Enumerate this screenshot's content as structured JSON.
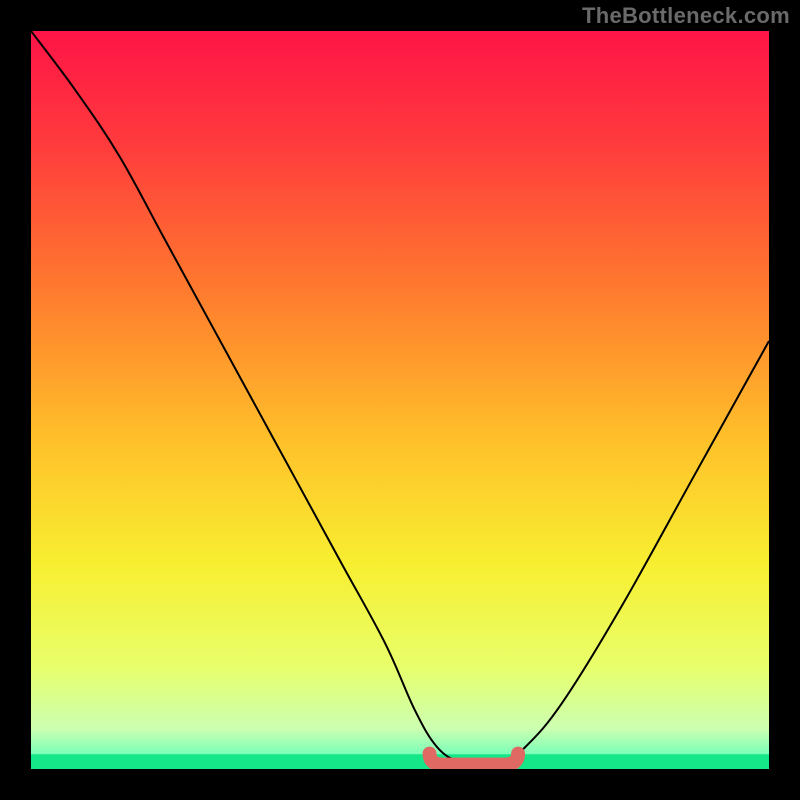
{
  "watermark": "TheBottleneck.com",
  "chart_data": {
    "type": "line",
    "title": "",
    "xlabel": "",
    "ylabel": "",
    "xlim": [
      0,
      100
    ],
    "ylim": [
      0,
      100
    ],
    "grid": false,
    "legend": false,
    "series": [
      {
        "name": "bottleneck-curve",
        "x": [
          0,
          6,
          12,
          18,
          24,
          30,
          36,
          42,
          48,
          52,
          55,
          58,
          61,
          64,
          67,
          72,
          80,
          90,
          100
        ],
        "y": [
          100,
          92,
          83,
          72,
          61,
          50,
          39,
          28,
          17,
          8,
          3,
          1,
          1,
          1,
          3,
          9,
          22,
          40,
          58
        ]
      }
    ],
    "highlight_zone": {
      "name": "flat-bottom-marker",
      "x_range": [
        54,
        66
      ],
      "y": 1
    },
    "background": {
      "type": "vertical-gradient",
      "stops": [
        {
          "pos": 0.0,
          "color": "#ff1447"
        },
        {
          "pos": 0.15,
          "color": "#ff3a3d"
        },
        {
          "pos": 0.35,
          "color": "#ff7a2e"
        },
        {
          "pos": 0.55,
          "color": "#ffbf2a"
        },
        {
          "pos": 0.72,
          "color": "#f8ee30"
        },
        {
          "pos": 0.86,
          "color": "#e8ff6a"
        },
        {
          "pos": 0.945,
          "color": "#ccffb0"
        },
        {
          "pos": 0.985,
          "color": "#6fffba"
        },
        {
          "pos": 1.0,
          "color": "#19e98b"
        }
      ]
    },
    "green_band": {
      "y_top": 0.0,
      "y_bottom": 0.02
    }
  }
}
